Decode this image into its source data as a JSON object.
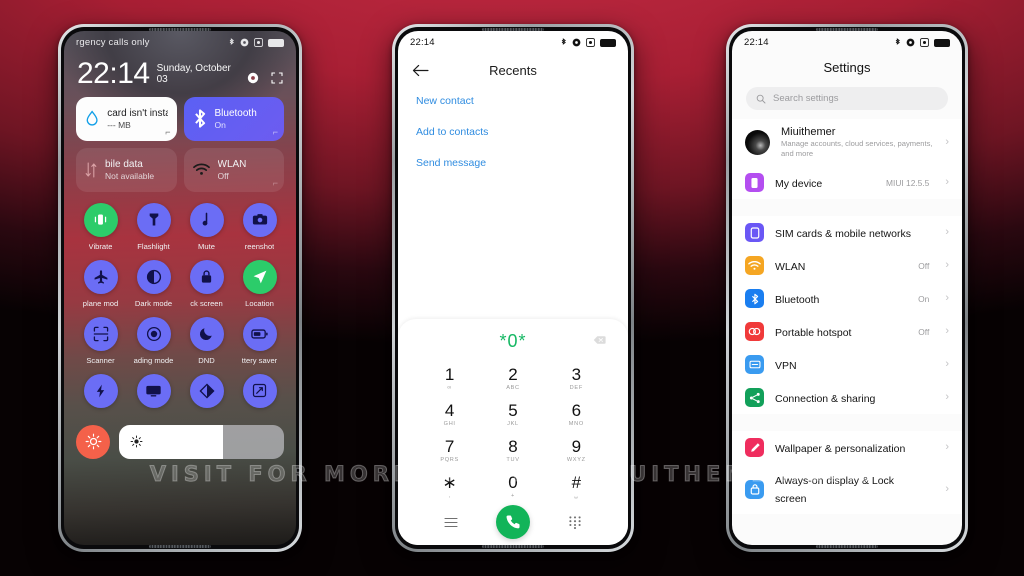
{
  "watermark": {
    "text": "VISIT FOR MORE THEMES - MIUITHEMER.COM"
  },
  "colors": {
    "background_top": "#b32236",
    "background_bottom": "#070203",
    "tile_blue": "#5b60f4",
    "toggle_blue": "#6b6df5",
    "toggle_green": "#2ccc6a",
    "brightness_red": "#f4614a",
    "dialer_green": "#12b459",
    "link_blue": "#2f8ce0"
  },
  "phone1": {
    "name": "control-center",
    "status": {
      "carrier": "rgency calls only",
      "icons": [
        "bluetooth-icon",
        "gear-icon",
        "alarm-icon",
        "battery-icon"
      ]
    },
    "clock": {
      "time": "22:14",
      "date": "Sunday, October 03"
    },
    "header_icons": [
      "settings-gear-icon",
      "expand-icon"
    ],
    "tiles": [
      {
        "name": "sim-data-tile",
        "title": "card isn't insta",
        "sub": "--- MB",
        "icon": "data-drop-icon",
        "style": "white"
      },
      {
        "name": "bluetooth-tile",
        "title": "Bluetooth",
        "sub": "On",
        "icon": "bluetooth-icon",
        "style": "blue"
      },
      {
        "name": "mobile-data-tile",
        "title": "bile data",
        "sub": "Not available",
        "icon": "mobile-data-icon",
        "style": "ghost"
      },
      {
        "name": "wlan-tile",
        "title": "WLAN",
        "sub": "Off",
        "icon": "wifi-icon",
        "style": "ghost"
      }
    ],
    "toggles": [
      {
        "label": "Vibrate",
        "icon": "vibrate-icon",
        "state": "on"
      },
      {
        "label": "Flashlight",
        "icon": "flashlight-icon",
        "state": "off"
      },
      {
        "label": "Mute",
        "icon": "mute-icon",
        "state": "off"
      },
      {
        "label": "reenshot",
        "icon": "screenshot-icon",
        "state": "off"
      },
      {
        "label": "plane mod",
        "icon": "airplane-icon",
        "state": "off"
      },
      {
        "label": "Dark mode",
        "icon": "dark-mode-icon",
        "state": "off"
      },
      {
        "label": "ck screen",
        "icon": "lock-icon",
        "state": "off"
      },
      {
        "label": "Location",
        "icon": "location-icon",
        "state": "on"
      },
      {
        "label": "Scanner",
        "icon": "scanner-icon",
        "state": "off"
      },
      {
        "label": "ading mode",
        "icon": "reading-mode-icon",
        "state": "off"
      },
      {
        "label": "DND",
        "icon": "moon-icon",
        "state": "off"
      },
      {
        "label": "ttery saver",
        "icon": "battery-saver-icon",
        "state": "off"
      },
      {
        "label": "",
        "icon": "power-bolt-icon",
        "state": "off"
      },
      {
        "label": "",
        "icon": "cast-icon",
        "state": "off"
      },
      {
        "label": "",
        "icon": "contrast-icon",
        "state": "off"
      },
      {
        "label": "",
        "icon": "fullscreen-icon",
        "state": "off"
      }
    ],
    "brightness": {
      "icon": "sun-icon",
      "button_icon": "auto-brightness-icon",
      "level_percent": 63
    }
  },
  "phone2": {
    "name": "dialer",
    "status": {
      "time": "22:14",
      "icons": [
        "bluetooth-icon",
        "gear-icon",
        "alarm-icon",
        "battery-icon"
      ]
    },
    "appbar": {
      "back_icon": "arrow-left-icon",
      "title": "Recents"
    },
    "links": [
      {
        "label": "New contact"
      },
      {
        "label": "Add to contacts"
      },
      {
        "label": "Send message"
      }
    ],
    "entry": {
      "number": "*0*",
      "backspace_icon": "backspace-icon"
    },
    "keys": [
      {
        "num": "1",
        "sub": "∞"
      },
      {
        "num": "2",
        "sub": "ABC"
      },
      {
        "num": "3",
        "sub": "DEF"
      },
      {
        "num": "4",
        "sub": "GHI"
      },
      {
        "num": "5",
        "sub": "JKL"
      },
      {
        "num": "6",
        "sub": "MNO"
      },
      {
        "num": "7",
        "sub": "PQRS"
      },
      {
        "num": "8",
        "sub": "TUV"
      },
      {
        "num": "9",
        "sub": "WXYZ"
      },
      {
        "num": "∗",
        "sub": ","
      },
      {
        "num": "0",
        "sub": "+"
      },
      {
        "num": "#",
        "sub": "␣"
      }
    ],
    "actions": {
      "left_icon": "menu-icon",
      "call_icon": "phone-call-icon",
      "right_icon": "keypad-icon"
    }
  },
  "phone3": {
    "name": "settings",
    "status": {
      "time": "22:14",
      "icons": [
        "bluetooth-icon",
        "gear-icon",
        "alarm-icon",
        "battery-icon"
      ]
    },
    "title": "Settings",
    "search": {
      "placeholder": "Search settings",
      "icon": "search-icon"
    },
    "account": {
      "name": "Miuithemer",
      "sub": "Manage accounts, cloud services, payments, and more",
      "avatar": "account-avatar"
    },
    "rows": [
      {
        "label": "My device",
        "value": "MIUI 12.5.5",
        "icon": "device-icon",
        "color": "#b44ef0"
      },
      {
        "label": "SIM cards & mobile networks",
        "value": "",
        "icon": "sim-icon",
        "color": "#6a57f5"
      },
      {
        "label": "WLAN",
        "value": "Off",
        "icon": "wifi-icon",
        "color": "#f5a623"
      },
      {
        "label": "Bluetooth",
        "value": "On",
        "icon": "bluetooth-icon",
        "color": "#1a7ef0"
      },
      {
        "label": "Portable hotspot",
        "value": "Off",
        "icon": "hotspot-icon",
        "color": "#f03a3a"
      },
      {
        "label": "VPN",
        "value": "",
        "icon": "vpn-icon",
        "color": "#3a9bf0"
      },
      {
        "label": "Connection & sharing",
        "value": "",
        "icon": "share-icon",
        "color": "#12a05a"
      },
      {
        "label": "Wallpaper & personalization",
        "value": "",
        "icon": "wallpaper-icon",
        "color": "#ef2d5e"
      },
      {
        "label": "Always-on display & Lock screen",
        "value": "",
        "icon": "lock-icon",
        "color": "#3a9bf0"
      }
    ]
  }
}
